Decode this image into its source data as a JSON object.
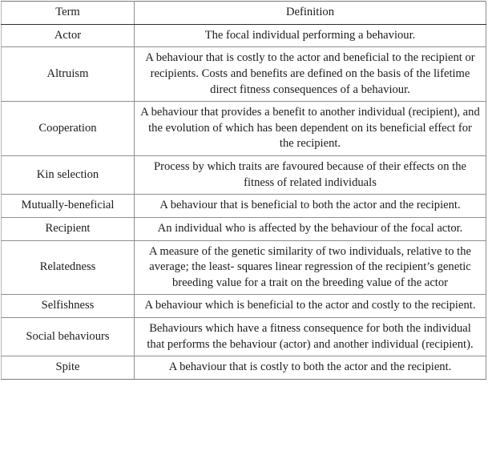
{
  "table": {
    "columns": [
      "Term",
      "Definition"
    ],
    "rows": [
      {
        "term": "Actor",
        "definition": "The focal individual performing a behaviour."
      },
      {
        "term": "Altruism",
        "definition": "A behaviour that is costly to the actor and beneficial to the recipient or recipients. Costs and benefits are defined on the basis of the lifetime direct fitness consequences of a behaviour."
      },
      {
        "term": "Cooperation",
        "definition": "A behaviour that provides a benefit to another individual (recipient), and the evolution of which has been dependent on its beneficial effect for the recipient."
      },
      {
        "term": "Kin selection",
        "definition": "Process by which traits are favoured because of their effects on the fitness of related individuals"
      },
      {
        "term": "Mutually-beneficial",
        "definition": "A behaviour that is beneficial to both the actor and the recipient."
      },
      {
        "term": "Recipient",
        "definition": "An individual who is affected by the behaviour of the focal actor."
      },
      {
        "term": "Relatedness",
        "definition": "A measure of the genetic similarity of two individuals, relative to the average; the least- squares linear regression of the recipient’s genetic breeding value for a trait on the breeding value of the actor"
      },
      {
        "term": "Selfishness",
        "definition": "A behaviour which is beneficial to the actor and costly to the recipient."
      },
      {
        "term": "Social behaviours",
        "definition": "Behaviours which have a fitness consequence for both the individual that performs the behaviour (actor) and another individual (recipient)."
      },
      {
        "term": "Spite",
        "definition": "A behaviour that is costly to both the actor and the recipient."
      }
    ]
  },
  "style": {
    "text_color": "#1b1b1b",
    "rule_color": "#8e8e8e",
    "background": "#ffffff"
  }
}
